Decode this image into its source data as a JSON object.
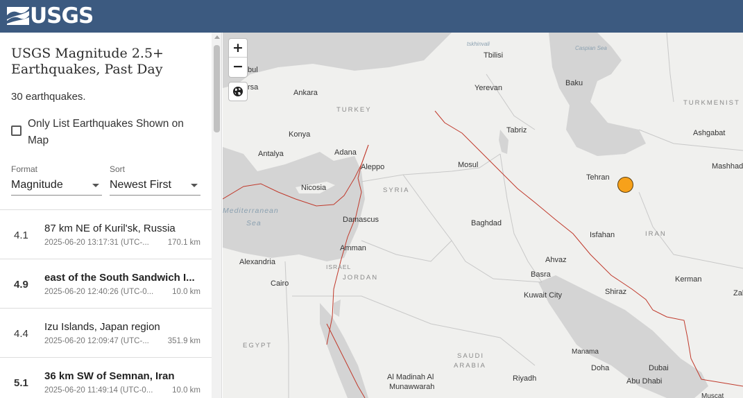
{
  "header": {
    "logo_text": "USGS",
    "logo_icon": "usgs-wave-logo",
    "background_color": "#3c5a80"
  },
  "sidebar": {
    "title": "USGS Magnitude 2.5+ Earthquakes, Past Day",
    "count_text": "30 earthquakes.",
    "only_list_label": "Only List Earthquakes Shown on Map",
    "only_list_checked": false,
    "format": {
      "label": "Format",
      "value": "Magnitude"
    },
    "sort": {
      "label": "Sort",
      "value": "Newest First"
    }
  },
  "earthquakes": [
    {
      "mag": "4.1",
      "place": "87 km NE of Kuril'sk, Russia",
      "time": "2025-06-20 13:17:31 (UTC-...",
      "depth": "170.1 km",
      "bold": false
    },
    {
      "mag": "4.9",
      "place": "east of the South Sandwich I...",
      "time": "2025-06-20 12:40:26 (UTC-0...",
      "depth": "10.0 km",
      "bold": true
    },
    {
      "mag": "4.4",
      "place": "Izu Islands, Japan region",
      "time": "2025-06-20 12:09:47 (UTC-...",
      "depth": "351.9 km",
      "bold": false
    },
    {
      "mag": "5.1",
      "place": "36 km SW of Semnan, Iran",
      "time": "2025-06-20 11:49:14 (UTC-0...",
      "depth": "10.0 km",
      "bold": true
    }
  ],
  "map": {
    "zoom_in": "+",
    "zoom_out": "−",
    "basemap_icon": "globe-icon",
    "marker_color": "#f7a11a",
    "labels": {
      "tskhinvali": "tskhinvali",
      "tbilisi": "Tbilisi",
      "caspian": "Caspian Sea",
      "istanbul": "bul",
      "bursa": "rsa",
      "ankara": "Ankara",
      "yerevan": "Yerevan",
      "baku": "Baku",
      "turkey": "TURKEY",
      "turkmenistan": "TURKMENIST",
      "tabriz": "Tabriz",
      "ashgabat": "Ashgabat",
      "konya": "Konya",
      "antalya": "Antalya",
      "adana": "Adana",
      "aleppo": "Aleppo",
      "mosul": "Mosul",
      "tehran": "Tehran",
      "mashhad": "Mashhad",
      "nicosia": "Nicosia",
      "syria": "SYRIA",
      "mediterranean": "Mediterranean",
      "sea": "Sea",
      "damascus": "Damascus",
      "baghdad": "Baghdad",
      "isfahan": "Isfahan",
      "iran": "IRAN",
      "amman": "Amman",
      "alexandria": "Alexandria",
      "israel": "ISRAEL",
      "ahvaz": "Ahvaz",
      "basra": "Basra",
      "jordan": "JORDAN",
      "cairo": "Cairo",
      "kerman": "Kerman",
      "kuwait": "Kuwait City",
      "shiraz": "Shiraz",
      "zahedan": "Zah",
      "egypt": "EGYPT",
      "manama": "Manama",
      "saudi": "SAUDI",
      "arabia": "ARABIA",
      "doha": "Doha",
      "dubai": "Dubai",
      "abudhabi": "Abu Dhabi",
      "madinah1": "Al Madinah Al",
      "madinah2": "Munawwarah",
      "riyadh": "Riyadh",
      "muscat": "Muscat"
    }
  }
}
